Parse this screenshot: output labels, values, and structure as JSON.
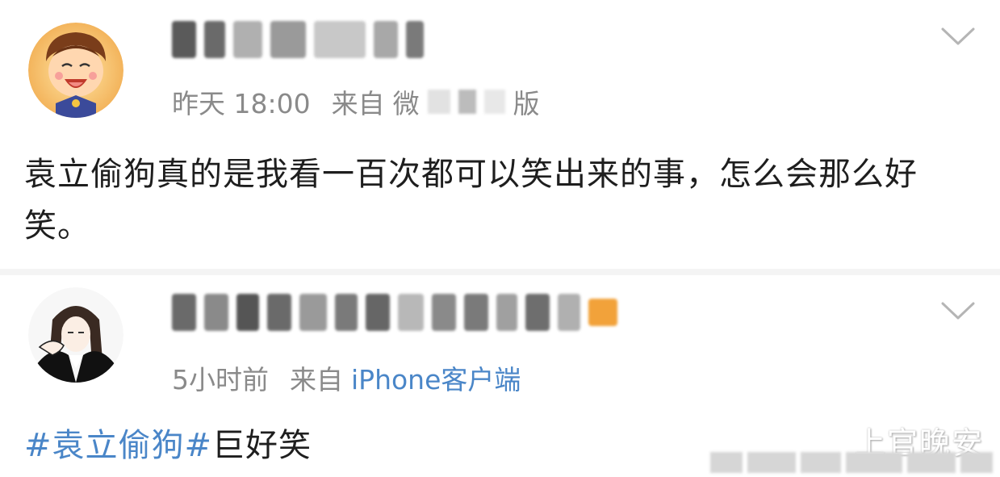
{
  "post1": {
    "avatar_icon": "cartoon-boy-avatar",
    "meta": {
      "time": "昨天 18:00",
      "from_label": "来自",
      "client_prefix": "微",
      "client_suffix": "版"
    },
    "content": "袁立偷狗真的是我看一百次都可以笑出来的事，怎么会那么好笑。"
  },
  "post2": {
    "avatar_icon": "anime-girl-avatar",
    "meta": {
      "time": "5小时前",
      "from_label": "来自",
      "client": "iPhone客户端"
    },
    "content_tag": "#袁立偷狗#",
    "content_rest": "巨好笑"
  },
  "watermark": {
    "text": "上官晚安"
  },
  "colors": {
    "link": "#4a86c8",
    "meta": "#8a8a8a",
    "text": "#1e1e1e"
  }
}
